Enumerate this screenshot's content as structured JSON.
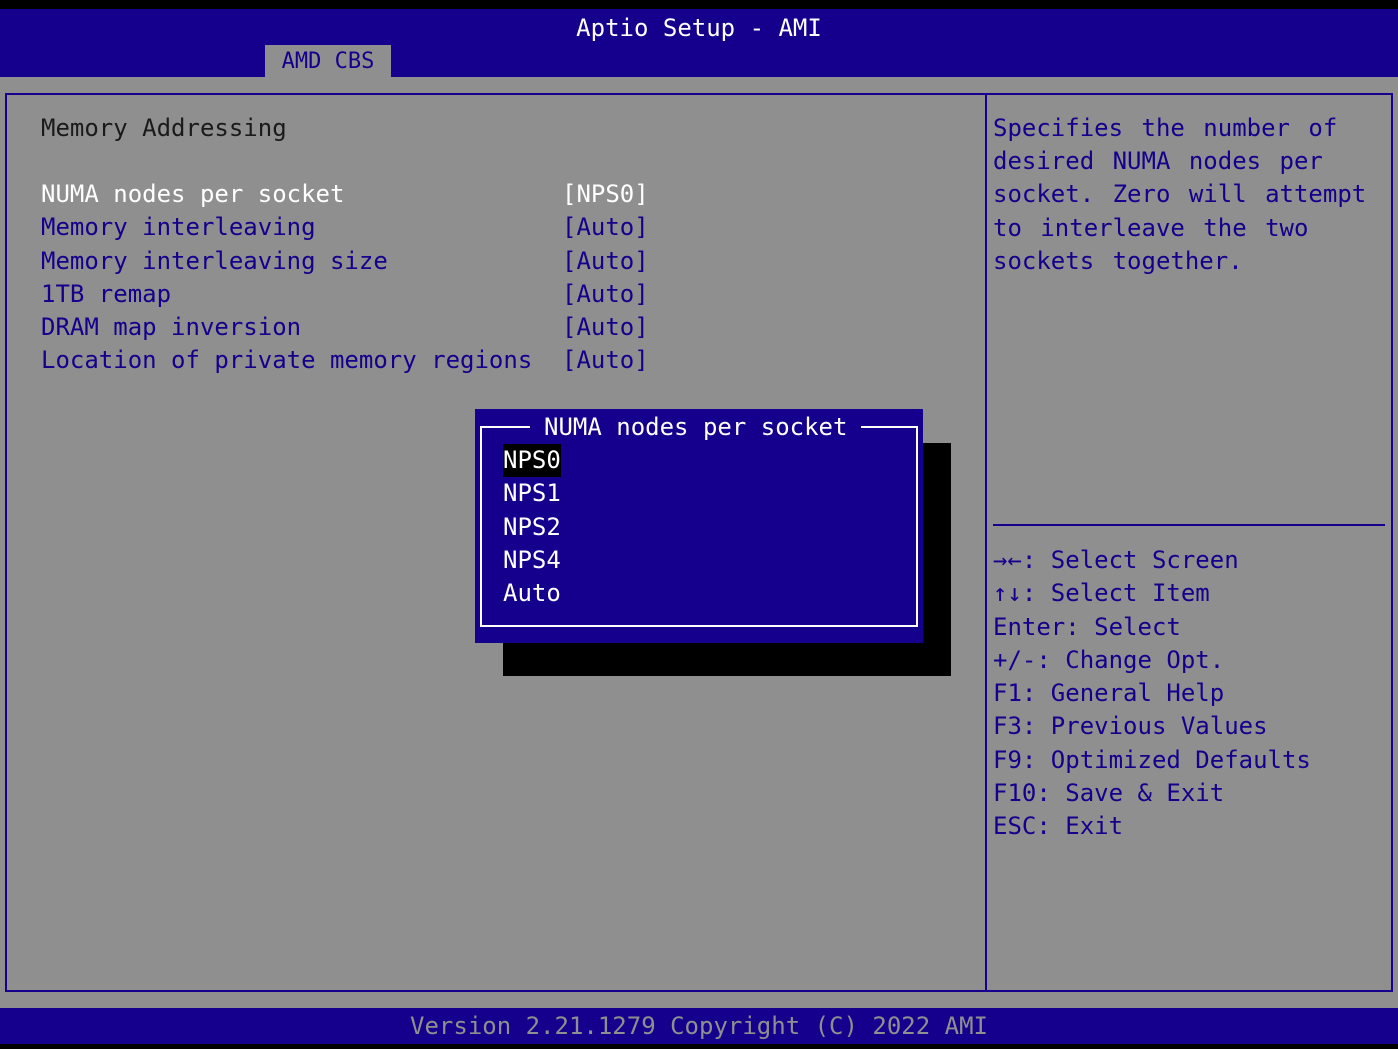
{
  "header": {
    "title": "Aptio Setup - AMI",
    "tab": "AMD CBS"
  },
  "main": {
    "section_title": "Memory Addressing",
    "settings": [
      {
        "label": "NUMA nodes per socket",
        "value": "[NPS0]"
      },
      {
        "label": "Memory interleaving",
        "value": "[Auto]"
      },
      {
        "label": "Memory interleaving size",
        "value": "[Auto]"
      },
      {
        "label": "1TB remap",
        "value": "[Auto]"
      },
      {
        "label": "DRAM map inversion",
        "value": "[Auto]"
      },
      {
        "label": "Location of private memory regions",
        "value": "[Auto]"
      }
    ]
  },
  "help": {
    "text": "Specifies the number of desired NUMA nodes per socket.  Zero will attempt to interleave the two sockets together.",
    "keys": [
      "→←: Select Screen",
      "↑↓: Select Item",
      "Enter: Select",
      "+/-: Change Opt.",
      "F1: General Help",
      "F3: Previous Values",
      "F9: Optimized Defaults",
      "F10: Save & Exit",
      "ESC: Exit"
    ]
  },
  "popup": {
    "title": "NUMA nodes per socket",
    "options": [
      "NPS0",
      "NPS1",
      "NPS2",
      "NPS4",
      "Auto"
    ],
    "selected_option": "NPS0"
  },
  "footer": {
    "version": "Version 2.21.1279 Copyright (C) 2022 AMI"
  },
  "colors": {
    "bios_blue": "#14008c",
    "panel_gray": "#8f8f8f",
    "text_white": "#ffffff"
  }
}
